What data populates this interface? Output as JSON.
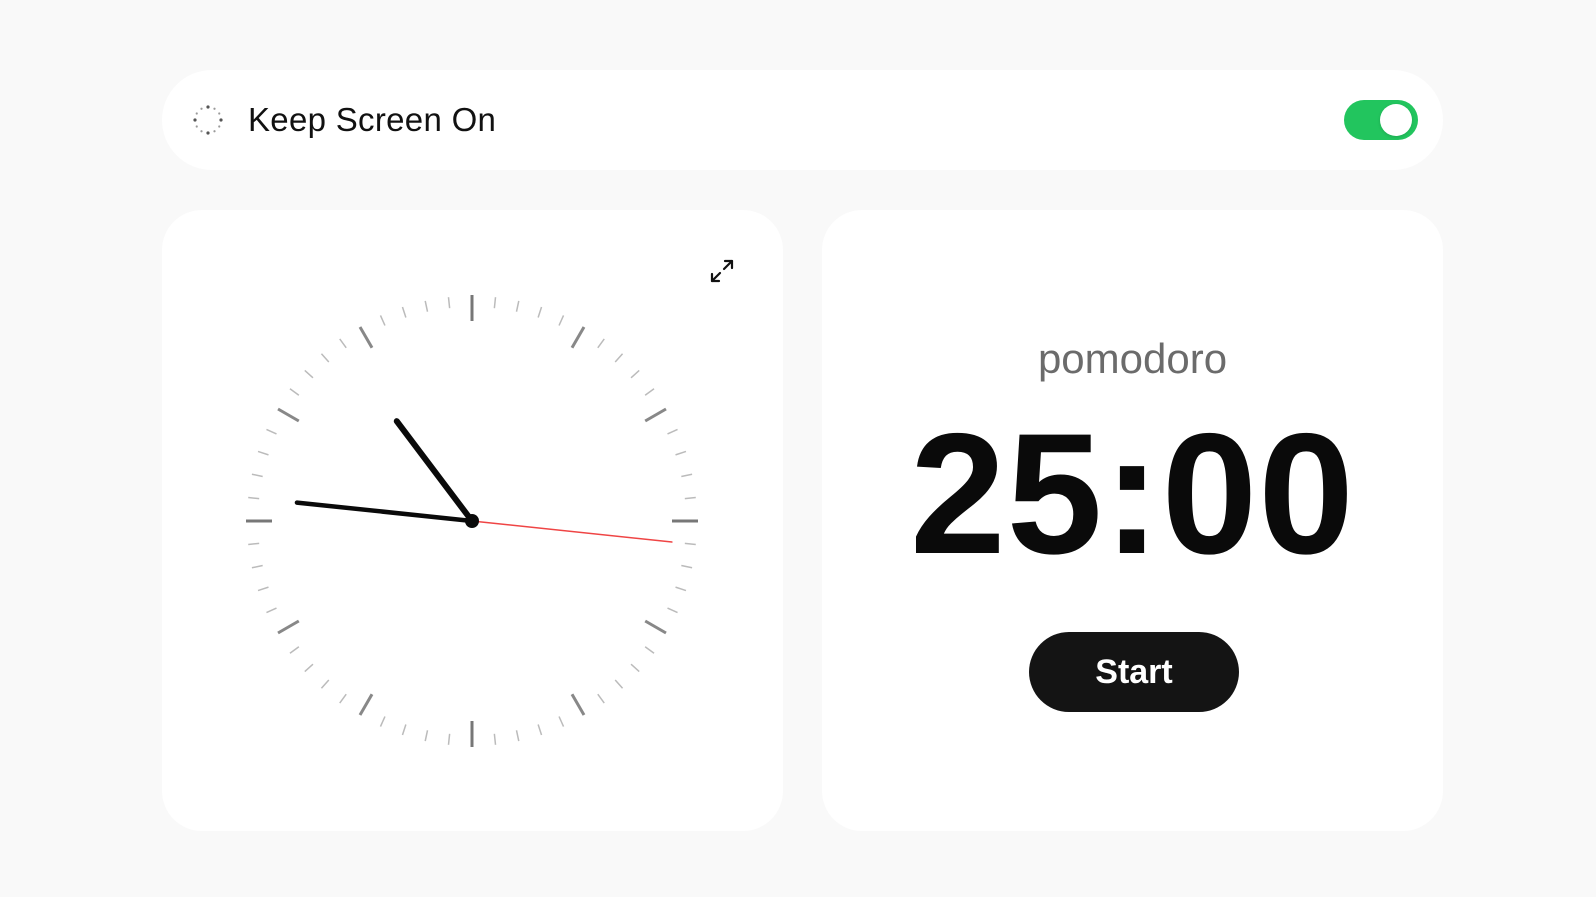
{
  "keep_screen": {
    "label": "Keep Screen On",
    "enabled": true,
    "icon": "sun-icon"
  },
  "clock": {
    "expand_icon": "expand-icon",
    "hour_hand_degrees": 323,
    "minute_hand_degrees": 276,
    "second_hand_degrees": 96,
    "second_hand_color": "#ef4444"
  },
  "pomodoro": {
    "label": "pomodoro",
    "time": "25:00",
    "start_label": "Start"
  },
  "colors": {
    "toggle_on": "#22c55e",
    "button_bg": "#141414",
    "background": "#f9f9f9"
  }
}
